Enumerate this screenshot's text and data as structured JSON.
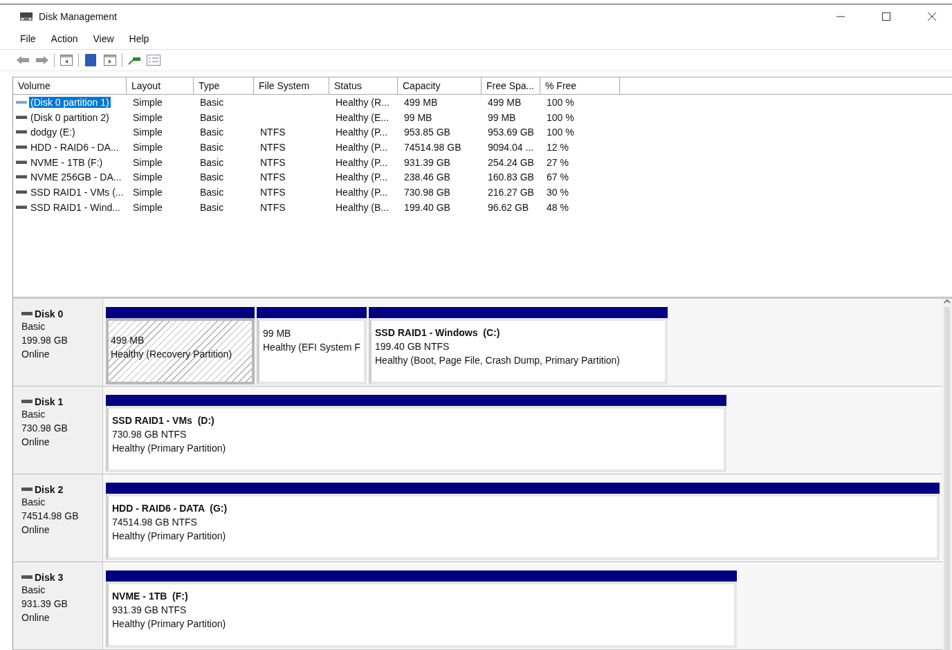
{
  "window": {
    "title": "Disk Management"
  },
  "menu": [
    "File",
    "Action",
    "View",
    "Help"
  ],
  "table": {
    "columns": [
      "Volume",
      "Layout",
      "Type",
      "File System",
      "Status",
      "Capacity",
      "Free Spa...",
      "% Free"
    ],
    "rows": [
      {
        "selected": true,
        "cells": [
          "(Disk 0 partition 1)",
          "Simple",
          "Basic",
          "",
          "Healthy (R...",
          "499 MB",
          "499 MB",
          "100 %"
        ]
      },
      {
        "selected": false,
        "cells": [
          "(Disk 0 partition 2)",
          "Simple",
          "Basic",
          "",
          "Healthy (E...",
          "99 MB",
          "99 MB",
          "100 %"
        ]
      },
      {
        "selected": false,
        "cells": [
          "dodgy (E:)",
          "Simple",
          "Basic",
          "NTFS",
          "Healthy (P...",
          "953.85 GB",
          "953.69 GB",
          "100 %"
        ]
      },
      {
        "selected": false,
        "cells": [
          "HDD - RAID6 - DA...",
          "Simple",
          "Basic",
          "NTFS",
          "Healthy (P...",
          "74514.98 GB",
          "9094.04 ...",
          "12 %"
        ]
      },
      {
        "selected": false,
        "cells": [
          "NVME - 1TB (F:)",
          "Simple",
          "Basic",
          "NTFS",
          "Healthy (P...",
          "931.39 GB",
          "254.24 GB",
          "27 %"
        ]
      },
      {
        "selected": false,
        "cells": [
          "NVME 256GB - DA...",
          "Simple",
          "Basic",
          "NTFS",
          "Healthy (P...",
          "238.46 GB",
          "160.83 GB",
          "67 %"
        ]
      },
      {
        "selected": false,
        "cells": [
          "SSD RAID1 - VMs (...",
          "Simple",
          "Basic",
          "NTFS",
          "Healthy (P...",
          "730.98 GB",
          "216.27 GB",
          "30 %"
        ]
      },
      {
        "selected": false,
        "cells": [
          "SSD RAID1 - Wind...",
          "Simple",
          "Basic",
          "NTFS",
          "Healthy (B...",
          "199.40 GB",
          "96.62 GB",
          "48 %"
        ]
      }
    ]
  },
  "disks": [
    {
      "name": "Disk 0",
      "type": "Basic",
      "size": "199.98 GB",
      "status": "Online",
      "partitions": [
        {
          "selected": true,
          "size": "499 MB",
          "status": "Healthy (Recovery Partition)"
        },
        {
          "selected": false,
          "size": "99 MB",
          "status": "Healthy (EFI System F"
        },
        {
          "selected": false,
          "title": "SSD RAID1 - Windows  (C:)",
          "size": "199.40 GB NTFS",
          "status": "Healthy (Boot, Page File, Crash Dump, Primary Partition)"
        }
      ]
    },
    {
      "name": "Disk 1",
      "type": "Basic",
      "size": "730.98 GB",
      "status": "Online",
      "partitions": [
        {
          "selected": false,
          "title": "SSD RAID1 - VMs  (D:)",
          "size": "730.98 GB NTFS",
          "status": "Healthy (Primary Partition)"
        }
      ]
    },
    {
      "name": "Disk 2",
      "type": "Basic",
      "size": "74514.98 GB",
      "status": "Online",
      "partitions": [
        {
          "selected": false,
          "title": "HDD - RAID6 - DATA  (G:)",
          "size": "74514.98 GB NTFS",
          "status": "Healthy (Primary Partition)"
        }
      ]
    },
    {
      "name": "Disk 3",
      "type": "Basic",
      "size": "931.39 GB",
      "status": "Online",
      "partitions": [
        {
          "selected": false,
          "title": "NVME - 1TB  (F:)",
          "size": "931.39 GB NTFS",
          "status": "Healthy (Primary Partition)"
        }
      ]
    }
  ]
}
